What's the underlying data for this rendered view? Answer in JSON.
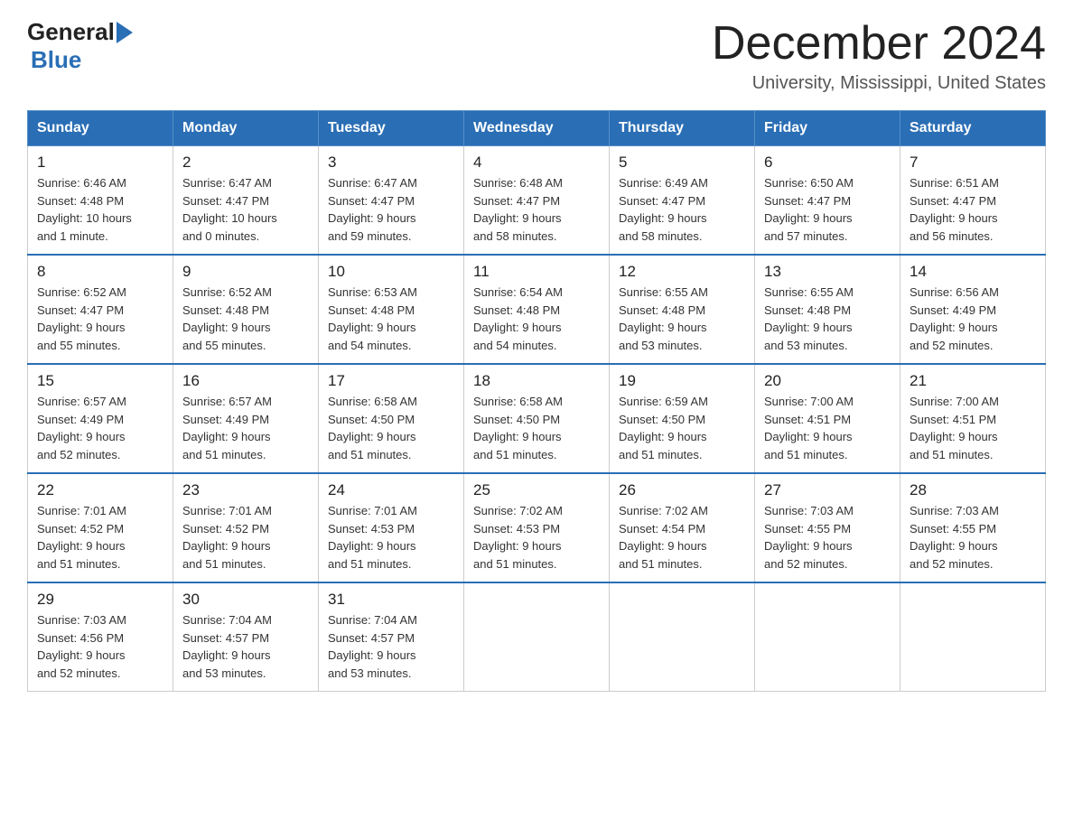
{
  "header": {
    "logo_general": "General",
    "logo_blue": "Blue",
    "title": "December 2024",
    "subtitle": "University, Mississippi, United States"
  },
  "days_of_week": [
    "Sunday",
    "Monday",
    "Tuesday",
    "Wednesday",
    "Thursday",
    "Friday",
    "Saturday"
  ],
  "weeks": [
    [
      {
        "day": "1",
        "sunrise": "6:46 AM",
        "sunset": "4:48 PM",
        "daylight": "10 hours and 1 minute."
      },
      {
        "day": "2",
        "sunrise": "6:47 AM",
        "sunset": "4:47 PM",
        "daylight": "10 hours and 0 minutes."
      },
      {
        "day": "3",
        "sunrise": "6:47 AM",
        "sunset": "4:47 PM",
        "daylight": "9 hours and 59 minutes."
      },
      {
        "day": "4",
        "sunrise": "6:48 AM",
        "sunset": "4:47 PM",
        "daylight": "9 hours and 58 minutes."
      },
      {
        "day": "5",
        "sunrise": "6:49 AM",
        "sunset": "4:47 PM",
        "daylight": "9 hours and 58 minutes."
      },
      {
        "day": "6",
        "sunrise": "6:50 AM",
        "sunset": "4:47 PM",
        "daylight": "9 hours and 57 minutes."
      },
      {
        "day": "7",
        "sunrise": "6:51 AM",
        "sunset": "4:47 PM",
        "daylight": "9 hours and 56 minutes."
      }
    ],
    [
      {
        "day": "8",
        "sunrise": "6:52 AM",
        "sunset": "4:47 PM",
        "daylight": "9 hours and 55 minutes."
      },
      {
        "day": "9",
        "sunrise": "6:52 AM",
        "sunset": "4:48 PM",
        "daylight": "9 hours and 55 minutes."
      },
      {
        "day": "10",
        "sunrise": "6:53 AM",
        "sunset": "4:48 PM",
        "daylight": "9 hours and 54 minutes."
      },
      {
        "day": "11",
        "sunrise": "6:54 AM",
        "sunset": "4:48 PM",
        "daylight": "9 hours and 54 minutes."
      },
      {
        "day": "12",
        "sunrise": "6:55 AM",
        "sunset": "4:48 PM",
        "daylight": "9 hours and 53 minutes."
      },
      {
        "day": "13",
        "sunrise": "6:55 AM",
        "sunset": "4:48 PM",
        "daylight": "9 hours and 53 minutes."
      },
      {
        "day": "14",
        "sunrise": "6:56 AM",
        "sunset": "4:49 PM",
        "daylight": "9 hours and 52 minutes."
      }
    ],
    [
      {
        "day": "15",
        "sunrise": "6:57 AM",
        "sunset": "4:49 PM",
        "daylight": "9 hours and 52 minutes."
      },
      {
        "day": "16",
        "sunrise": "6:57 AM",
        "sunset": "4:49 PM",
        "daylight": "9 hours and 51 minutes."
      },
      {
        "day": "17",
        "sunrise": "6:58 AM",
        "sunset": "4:50 PM",
        "daylight": "9 hours and 51 minutes."
      },
      {
        "day": "18",
        "sunrise": "6:58 AM",
        "sunset": "4:50 PM",
        "daylight": "9 hours and 51 minutes."
      },
      {
        "day": "19",
        "sunrise": "6:59 AM",
        "sunset": "4:50 PM",
        "daylight": "9 hours and 51 minutes."
      },
      {
        "day": "20",
        "sunrise": "7:00 AM",
        "sunset": "4:51 PM",
        "daylight": "9 hours and 51 minutes."
      },
      {
        "day": "21",
        "sunrise": "7:00 AM",
        "sunset": "4:51 PM",
        "daylight": "9 hours and 51 minutes."
      }
    ],
    [
      {
        "day": "22",
        "sunrise": "7:01 AM",
        "sunset": "4:52 PM",
        "daylight": "9 hours and 51 minutes."
      },
      {
        "day": "23",
        "sunrise": "7:01 AM",
        "sunset": "4:52 PM",
        "daylight": "9 hours and 51 minutes."
      },
      {
        "day": "24",
        "sunrise": "7:01 AM",
        "sunset": "4:53 PM",
        "daylight": "9 hours and 51 minutes."
      },
      {
        "day": "25",
        "sunrise": "7:02 AM",
        "sunset": "4:53 PM",
        "daylight": "9 hours and 51 minutes."
      },
      {
        "day": "26",
        "sunrise": "7:02 AM",
        "sunset": "4:54 PM",
        "daylight": "9 hours and 51 minutes."
      },
      {
        "day": "27",
        "sunrise": "7:03 AM",
        "sunset": "4:55 PM",
        "daylight": "9 hours and 52 minutes."
      },
      {
        "day": "28",
        "sunrise": "7:03 AM",
        "sunset": "4:55 PM",
        "daylight": "9 hours and 52 minutes."
      }
    ],
    [
      {
        "day": "29",
        "sunrise": "7:03 AM",
        "sunset": "4:56 PM",
        "daylight": "9 hours and 52 minutes."
      },
      {
        "day": "30",
        "sunrise": "7:04 AM",
        "sunset": "4:57 PM",
        "daylight": "9 hours and 53 minutes."
      },
      {
        "day": "31",
        "sunrise": "7:04 AM",
        "sunset": "4:57 PM",
        "daylight": "9 hours and 53 minutes."
      },
      null,
      null,
      null,
      null
    ]
  ],
  "labels": {
    "sunrise": "Sunrise:",
    "sunset": "Sunset:",
    "daylight": "Daylight:"
  }
}
